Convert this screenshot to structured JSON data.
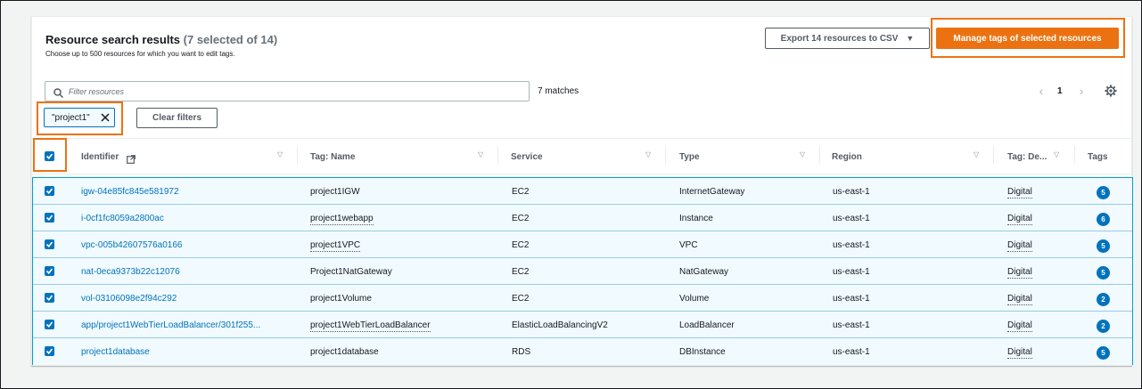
{
  "header": {
    "title": "Resource search results",
    "count": "(7 selected of 14)",
    "description": "Choose up to 500 resources for which you want to edit tags.",
    "export_label": "Export 14 resources to CSV",
    "manage_label": "Manage tags of selected resources"
  },
  "filter": {
    "placeholder": "Filter resources",
    "matches": "7 matches",
    "token": "\"project1\"",
    "clear_label": "Clear filters"
  },
  "pagination": {
    "current": "1"
  },
  "columns": [
    "Identifier",
    "Tag: Name",
    "Service",
    "Type",
    "Region",
    "Tag: De...",
    "Tags"
  ],
  "rows": [
    {
      "identifier": "igw-04e85fc845e581972",
      "tag_name": "project1IGW",
      "service": "EC2",
      "type": "InternetGateway",
      "region": "us-east-1",
      "tag_de": "Digital",
      "tags": "5"
    },
    {
      "identifier": "i-0cf1fc8059a2800ac",
      "tag_name": "project1webapp",
      "service": "EC2",
      "type": "Instance",
      "region": "us-east-1",
      "tag_de": "Digital",
      "tags": "6"
    },
    {
      "identifier": "vpc-005b42607576a0166",
      "tag_name": "project1VPC",
      "service": "EC2",
      "type": "VPC",
      "region": "us-east-1",
      "tag_de": "Digital",
      "tags": "5"
    },
    {
      "identifier": "nat-0eca9373b22c12076",
      "tag_name": "Project1NatGateway",
      "service": "EC2",
      "type": "NatGateway",
      "region": "us-east-1",
      "tag_de": "Digital",
      "tags": "5"
    },
    {
      "identifier": "vol-03106098e2f94c292",
      "tag_name": "project1Volume",
      "service": "EC2",
      "type": "Volume",
      "region": "us-east-1",
      "tag_de": "Digital",
      "tags": "2"
    },
    {
      "identifier": "app/project1WebTierLoadBalancer/301f255...",
      "tag_name": "project1WebTierLoadBalancer",
      "service": "ElasticLoadBalancingV2",
      "type": "LoadBalancer",
      "region": "us-east-1",
      "tag_de": "Digital",
      "tags": "2"
    },
    {
      "identifier": "project1database",
      "tag_name": "project1database",
      "service": "RDS",
      "type": "DBInstance",
      "region": "us-east-1",
      "tag_de": "Digital",
      "tags": "5"
    }
  ],
  "colors": {
    "accent_orange": "#ec7211",
    "link_blue": "#0073bb",
    "selected_row_bg": "#f1faff"
  },
  "icons": [
    "search-icon",
    "close-icon",
    "external-link-icon",
    "sort-icon",
    "chevron-left-icon",
    "chevron-right-icon",
    "settings-icon",
    "checkbox-checked-icon",
    "caret-down-icon"
  ]
}
